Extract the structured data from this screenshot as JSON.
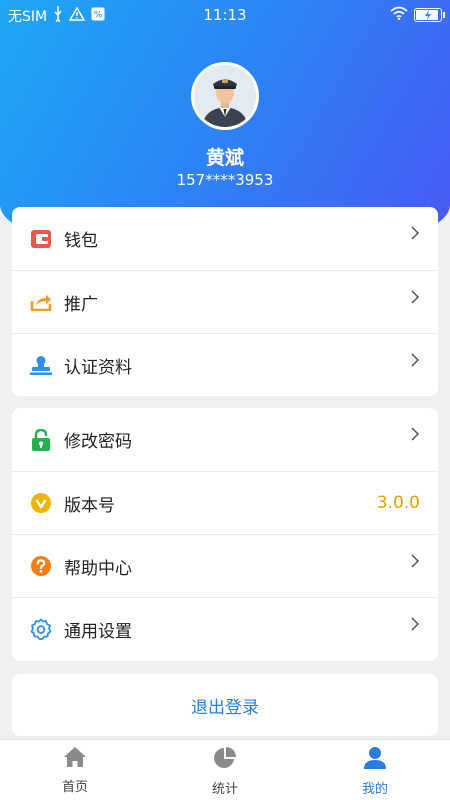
{
  "status_bar": {
    "carrier": "无SIM",
    "time": "11:13",
    "icons": [
      "usb-icon",
      "warning-icon",
      "app-notification-icon",
      "wifi-icon",
      "battery-charging-icon"
    ]
  },
  "profile": {
    "name": "黄斌",
    "phone": "157****3953"
  },
  "menu_group_1": [
    {
      "label": "钱包",
      "icon": "wallet-icon",
      "color": "#e8574a"
    },
    {
      "label": "推广",
      "icon": "share-icon",
      "color": "#f59a23"
    },
    {
      "label": "认证资料",
      "icon": "certification-icon",
      "color": "#2f8ef0"
    }
  ],
  "menu_group_2": [
    {
      "label": "修改密码",
      "icon": "lock-icon",
      "color": "#22b14c"
    },
    {
      "label": "版本号",
      "icon": "version-icon",
      "color": "#f0b400",
      "value": "3.0.0"
    },
    {
      "label": "帮助中心",
      "icon": "help-icon",
      "color": "#f57e14"
    },
    {
      "label": "通用设置",
      "icon": "settings-icon",
      "color": "#2f8ef0"
    }
  ],
  "logout_label": "退出登录",
  "tabs": [
    {
      "label": "首页",
      "icon": "home-icon"
    },
    {
      "label": "统计",
      "icon": "chart-icon"
    },
    {
      "label": "我的",
      "icon": "profile-icon",
      "active": true
    }
  ],
  "colors": {
    "accent": "#2a7ddb",
    "gradient_start": "#1ea8f5",
    "gradient_end": "#4a58f3",
    "version_value": "#e0a200"
  }
}
